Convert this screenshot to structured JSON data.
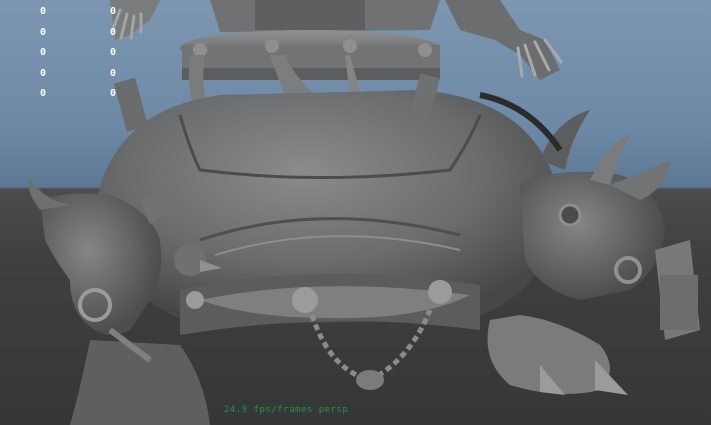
{
  "viewport": {
    "hud_rows": [
      {
        "left": "0",
        "right": "0"
      },
      {
        "left": "0",
        "right": "0"
      },
      {
        "left": "0",
        "right": "0"
      },
      {
        "left": "0",
        "right": "0"
      },
      {
        "left": "0",
        "right": "0"
      }
    ],
    "status_text": "24.9 fps/frames     persp",
    "colors": {
      "sky_top": "#7d97b2",
      "ground": "#3e4042",
      "model": "#6a6b6c",
      "hud_text": "#ffffff",
      "status_text": "#1e9a3a"
    }
  },
  "model": {
    "icon": "3d-model-icon"
  }
}
